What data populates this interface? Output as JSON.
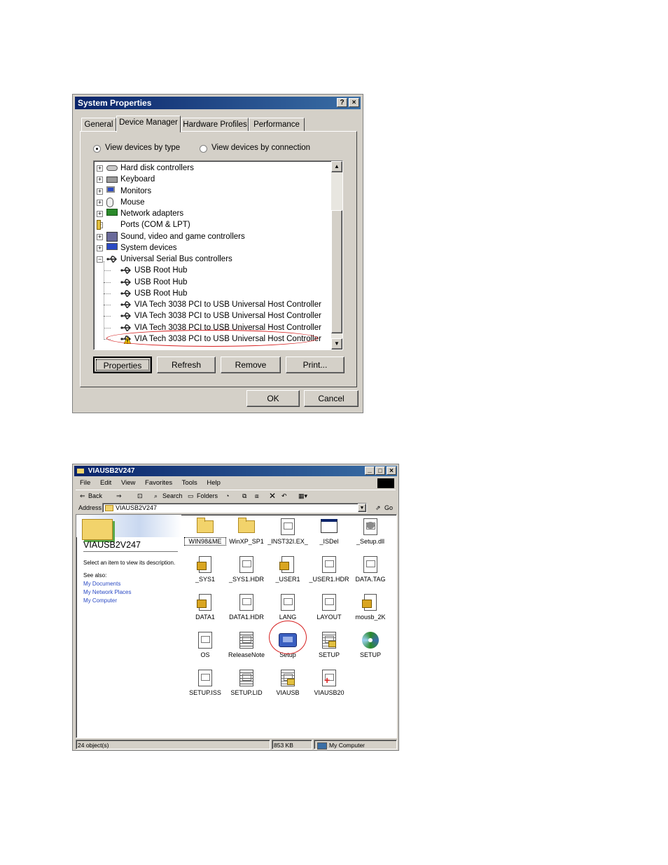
{
  "sysprops": {
    "title": "System Properties",
    "help": "?",
    "close": "×",
    "tabs": [
      "General",
      "Device Manager",
      "Hardware Profiles",
      "Performance"
    ],
    "radio_type": "View devices by type",
    "radio_connection": "View devices by connection",
    "tree": [
      {
        "label": "Hard disk controllers",
        "icon": "disk-controller-icon",
        "level": 0,
        "expander": "+"
      },
      {
        "label": "Keyboard",
        "icon": "keyboard-icon",
        "level": 0,
        "expander": "+"
      },
      {
        "label": "Monitors",
        "icon": "monitor-icon",
        "level": 0,
        "expander": "+"
      },
      {
        "label": "Mouse",
        "icon": "mouse-icon",
        "level": 0,
        "expander": "+"
      },
      {
        "label": "Network adapters",
        "icon": "network-adapter-icon",
        "level": 0,
        "expander": "+"
      },
      {
        "label": "Ports (COM & LPT)",
        "icon": "port-icon",
        "level": 0,
        "expander": "+"
      },
      {
        "label": "Sound, video and game controllers",
        "icon": "sound-icon",
        "level": 0,
        "expander": "+"
      },
      {
        "label": "System devices",
        "icon": "computer-icon",
        "level": 0,
        "expander": "+"
      },
      {
        "label": "Universal Serial Bus controllers",
        "icon": "usb-icon",
        "level": 0,
        "expander": "−"
      },
      {
        "label": "USB Root Hub",
        "icon": "usb-icon",
        "level": 1
      },
      {
        "label": "USB Root Hub",
        "icon": "usb-icon",
        "level": 1
      },
      {
        "label": "USB Root Hub",
        "icon": "usb-icon",
        "level": 1
      },
      {
        "label": "VIA Tech 3038 PCI to USB Universal Host Controller",
        "icon": "usb-icon",
        "level": 1
      },
      {
        "label": "VIA Tech 3038 PCI to USB Universal Host Controller",
        "icon": "usb-icon",
        "level": 1
      },
      {
        "label": "VIA Tech 3038 PCI to USB Universal Host Controller",
        "icon": "usb-icon",
        "level": 1
      },
      {
        "label": "VIA Tech 3038 PCI to USB Universal Host Controller",
        "icon": "usb-warning-icon",
        "level": 1
      }
    ],
    "buttons": {
      "properties": "Properties",
      "refresh": "Refresh",
      "remove": "Remove",
      "print": "Print..."
    },
    "ok": "OK",
    "cancel": "Cancel",
    "colors": {
      "highlight_circle": "#d62020"
    }
  },
  "explorer": {
    "title": "VIAUSB2V247",
    "menu": [
      "File",
      "Edit",
      "View",
      "Favorites",
      "Tools",
      "Help"
    ],
    "toolbar": {
      "back": "Back",
      "search": "Search",
      "folders": "Folders"
    },
    "address_label": "Address",
    "address_value": "VIAUSB2V247",
    "go": "Go",
    "sidebar": {
      "folder_name": "VIAUSB2V247",
      "description": "Select an item to view its description.",
      "see_also": "See also:",
      "links": [
        "My Documents",
        "My Network Places",
        "My Computer"
      ]
    },
    "files": [
      {
        "name": "WIN98&ME",
        "icon": "folder-icon",
        "kind": "folder"
      },
      {
        "name": "WinXP_SP1",
        "icon": "folder-icon",
        "kind": "folder"
      },
      {
        "name": "_INST32I.EX_",
        "icon": "file-icon",
        "kind": "doc"
      },
      {
        "name": "_ISDel",
        "icon": "application-icon",
        "kind": "app"
      },
      {
        "name": "_Setup.dll",
        "icon": "dll-icon",
        "kind": "dll"
      },
      {
        "name": "_SYS1",
        "icon": "installer-icon",
        "kind": "inst"
      },
      {
        "name": "_SYS1.HDR",
        "icon": "file-icon",
        "kind": "doc"
      },
      {
        "name": "_USER1",
        "icon": "installer-icon",
        "kind": "inst"
      },
      {
        "name": "_USER1.HDR",
        "icon": "file-icon",
        "kind": "doc"
      },
      {
        "name": "DATA.TAG",
        "icon": "file-icon",
        "kind": "doc"
      },
      {
        "name": "DATA1",
        "icon": "installer-icon",
        "kind": "inst"
      },
      {
        "name": "DATA1.HDR",
        "icon": "file-icon",
        "kind": "doc"
      },
      {
        "name": "LANG",
        "icon": "file-icon",
        "kind": "doc"
      },
      {
        "name": "LAYOUT",
        "icon": "file-icon",
        "kind": "doc"
      },
      {
        "name": "mousb_2K",
        "icon": "installer-icon",
        "kind": "inst"
      },
      {
        "name": "OS",
        "icon": "file-icon",
        "kind": "doc"
      },
      {
        "name": "ReleaseNote",
        "icon": "text-file-icon",
        "kind": "txt"
      },
      {
        "name": "Setup",
        "icon": "setup-icon",
        "kind": "setup"
      },
      {
        "name": "SETUP",
        "icon": "config-file-icon",
        "kind": "ini"
      },
      {
        "name": "SETUP",
        "icon": "disc-icon",
        "kind": "disc"
      },
      {
        "name": "SETUP.ISS",
        "icon": "file-icon",
        "kind": "doc"
      },
      {
        "name": "SETUP.LID",
        "icon": "text-file-icon",
        "kind": "txt"
      },
      {
        "name": "VIAUSB",
        "icon": "config-file-icon",
        "kind": "ini"
      },
      {
        "name": "VIAUSB20",
        "icon": "inf-file-icon",
        "kind": "inf"
      }
    ],
    "status": {
      "objects": "24 object(s)",
      "size": "853 KB",
      "zone": "My Computer"
    }
  }
}
